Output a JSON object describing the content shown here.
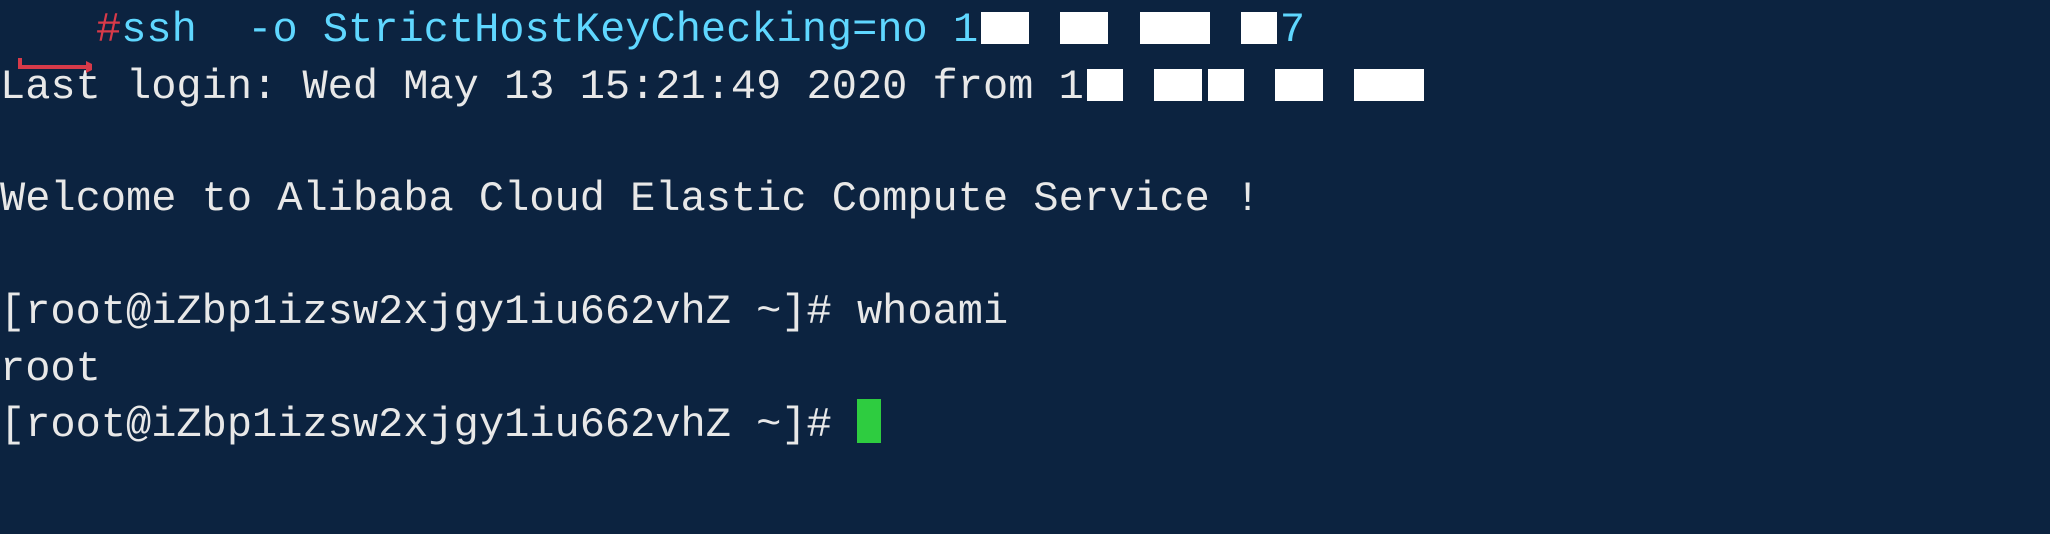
{
  "line1": {
    "hash": "#",
    "command": "ssh  -o StrictHostKeyChecking=no 1",
    "ip_partial_end": "7"
  },
  "line2": {
    "prefix": "Last login: Wed May 13 15:21:49 2020 from 1"
  },
  "welcome": "Welcome to Alibaba Cloud Elastic Compute Service !",
  "prompt1": {
    "full": "[root@iZbp1izsw2xjgy1iu662vhZ ~]# ",
    "command": "whoami"
  },
  "output1": "root",
  "prompt2": {
    "full": "[root@iZbp1izsw2xjgy1iu662vhZ ~]# "
  }
}
